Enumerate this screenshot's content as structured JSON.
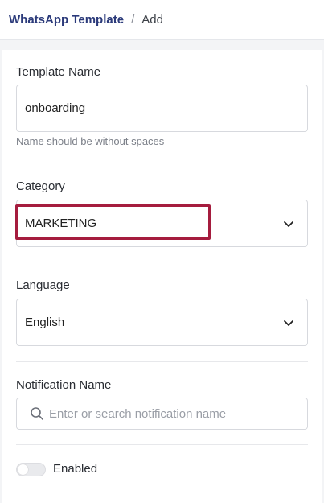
{
  "breadcrumb": {
    "parent": "WhatsApp Template",
    "separator": "/",
    "current": "Add"
  },
  "form": {
    "template_name": {
      "label": "Template Name",
      "value": "onboarding",
      "hint": "Name should be without spaces"
    },
    "category": {
      "label": "Category",
      "value": "MARKETING",
      "icon": "chevron-down-icon"
    },
    "language": {
      "label": "Language",
      "value": "English",
      "icon": "chevron-down-icon"
    },
    "notification_name": {
      "label": "Notification Name",
      "placeholder": "Enter or search notification name",
      "icon": "search-icon"
    },
    "enabled_toggle": {
      "label": "Enabled",
      "checked": false
    }
  },
  "colors": {
    "breadcrumb_link": "#2b3a7a",
    "highlight": "#a51c3e"
  }
}
